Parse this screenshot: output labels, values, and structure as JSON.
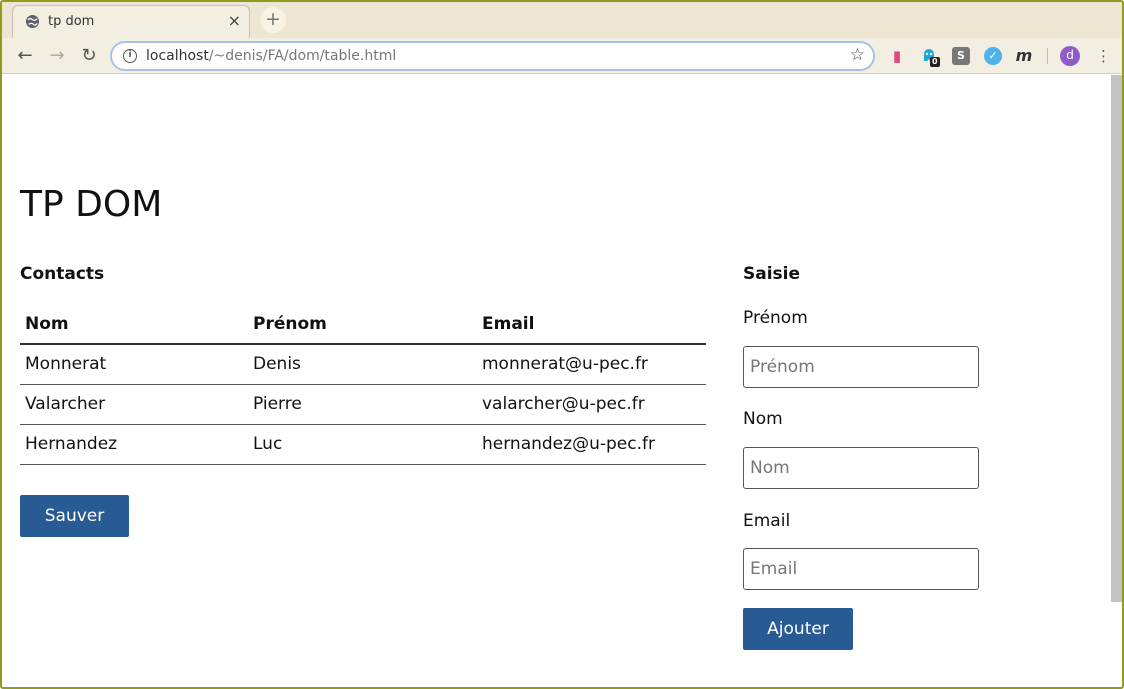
{
  "browser": {
    "tab": {
      "title": "tp dom",
      "close": "×"
    },
    "newtab": "+",
    "nav": {
      "back": "←",
      "forward": "→",
      "reload": "↻"
    },
    "url_host": "localhost",
    "url_path": "/~denis/FA/dom/table.html",
    "info": "i",
    "star": "☆",
    "extensions": [
      {
        "name": "extension-pink",
        "glyph": "❚",
        "color": "#e0457b"
      },
      {
        "name": "extension-ghost",
        "glyph": "👻",
        "color": "#1aa7d8",
        "badge": "0"
      },
      {
        "name": "extension-s",
        "glyph": "S",
        "color": "#777777"
      },
      {
        "name": "extension-v",
        "glyph": "✓",
        "color": "#4fb3e8"
      },
      {
        "name": "extension-m",
        "glyph": "m",
        "color": "#333333"
      }
    ],
    "avatar": "d",
    "menu": "⋮"
  },
  "page": {
    "title": "TP DOM",
    "contacts": {
      "heading": "Contacts",
      "columns": [
        "Nom",
        "Prénom",
        "Email"
      ],
      "rows": [
        [
          "Monnerat",
          "Denis",
          "monnerat@u-pec.fr"
        ],
        [
          "Valarcher",
          "Pierre",
          "valarcher@u-pec.fr"
        ],
        [
          "Hernandez",
          "Luc",
          "hernandez@u-pec.fr"
        ]
      ],
      "save_label": "Sauver"
    },
    "form": {
      "heading": "Saisie",
      "prenom_label": "Prénom",
      "prenom_placeholder": "Prénom",
      "nom_label": "Nom",
      "nom_placeholder": "Nom",
      "email_label": "Email",
      "email_placeholder": "Email",
      "add_label": "Ajouter"
    }
  },
  "colors": {
    "accent": "#285a93",
    "window_border": "#8f9a1e"
  }
}
